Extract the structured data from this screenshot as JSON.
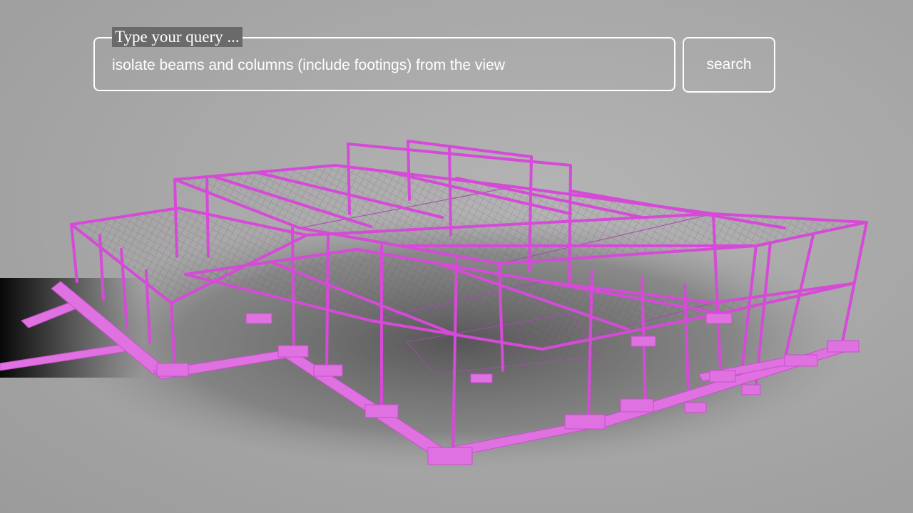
{
  "search": {
    "legend": "Type your query ...",
    "value": "isolate beams and columns (include footings) from the view",
    "button_label": "search"
  },
  "viewer": {
    "element_color": "#d64ad8",
    "slab_mesh_color": "#b048b8",
    "background_color": "#a5a5a5"
  }
}
